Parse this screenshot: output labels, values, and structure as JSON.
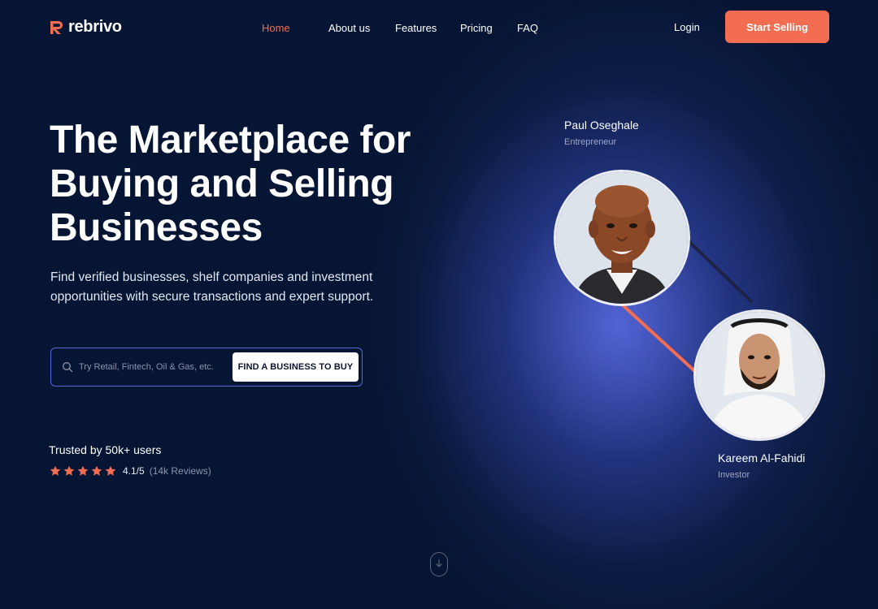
{
  "brand": {
    "name": "rebrivo",
    "accent": "#f26d52",
    "background": "#061533",
    "glow": "#5c6ce6"
  },
  "nav": {
    "links": [
      {
        "label": "Home",
        "active": true
      },
      {
        "label": "About us",
        "active": false
      },
      {
        "label": "Features",
        "active": false
      },
      {
        "label": "Pricing",
        "active": false
      },
      {
        "label": "FAQ",
        "active": false
      }
    ],
    "login_label": "Login",
    "cta_label": "Start Selling"
  },
  "hero": {
    "title": "The Marketplace for Buying and Selling Businesses",
    "subtitle": "Find verified businesses, shelf companies and investment opportunities with secure transactions and expert support."
  },
  "search": {
    "placeholder": "Try Retail, Fintech, Oil & Gas, etc.",
    "icon": "search-icon",
    "button_label": "FIND A BUSINESS TO BUY"
  },
  "social_proof": {
    "trusted_text": "Trusted by 50k+ users",
    "stars": 5,
    "rating": "4.1/5",
    "reviews": "(14k Reviews)"
  },
  "people": [
    {
      "name": "Paul Oseghale",
      "role": "Entrepreneur"
    },
    {
      "name": "Kareem Al-Fahidi",
      "role": "Investor"
    }
  ],
  "scroll_indicator": {
    "icon": "chevron-down-icon"
  }
}
